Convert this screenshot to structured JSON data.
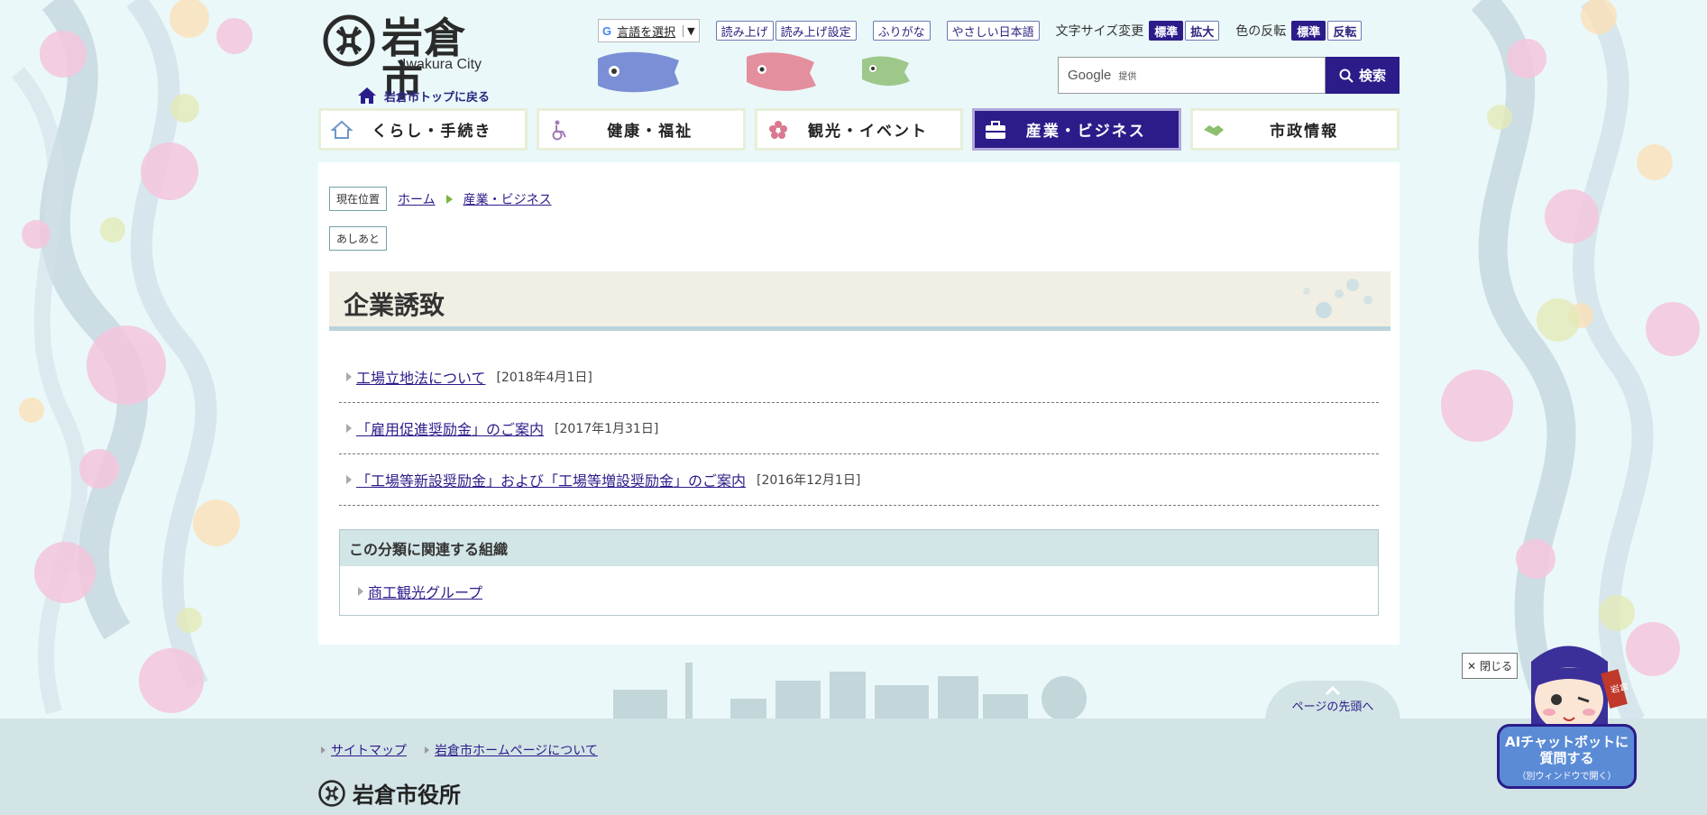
{
  "header": {
    "logo_title": "岩倉市",
    "logo_sub": "Iwakura City",
    "home_link": "岩倉市トップに戻る"
  },
  "util": {
    "lang_google": "G",
    "lang_label": "言語を選択",
    "lang_arrow": "▼",
    "read_aloud": "読み上げ",
    "read_settings": "読み上げ設定",
    "furigana": "ふりがな",
    "easy_japanese": "やさしい日本語",
    "font_size_label": "文字サイズ変更",
    "font_standard": "標準",
    "font_large": "拡大",
    "color_label": "色の反転",
    "color_standard": "標準",
    "color_invert": "反転"
  },
  "search": {
    "google": "Google",
    "provided": "提供",
    "button": "検索"
  },
  "nav": {
    "items": [
      {
        "label": "くらし・手続き"
      },
      {
        "label": "健康・福祉"
      },
      {
        "label": "観光・イベント"
      },
      {
        "label": "産業・ビジネス"
      },
      {
        "label": "市政情報"
      }
    ]
  },
  "breadcrumb": {
    "current_label": "現在位置",
    "home": "ホーム",
    "current": "産業・ビジネス",
    "ashiato": "あしあと"
  },
  "page": {
    "title": "企業誘致"
  },
  "articles": [
    {
      "title": "工場立地法について",
      "date": "[2018年4月1日]"
    },
    {
      "title": "「雇用促進奨励金」のご案内",
      "date": "[2017年1月31日]"
    },
    {
      "title": "「工場等新設奨励金」および「工場等増設奨励金」のご案内",
      "date": "[2016年12月1日]"
    }
  ],
  "org": {
    "heading": "この分類に関連する組織",
    "link": "商工観光グループ"
  },
  "footer": {
    "pagetop": "ページの先頭へ",
    "sitemap": "サイトマップ",
    "about": "岩倉市ホームページについて",
    "office": "岩倉市役所"
  },
  "chatbot": {
    "close": "閉じる",
    "line1": "AIチャットボットに",
    "line2": "質問する",
    "line3": "（別ウィンドウで開く）",
    "badge": "岩倉"
  },
  "colors": {
    "accent": "#2b1c8a",
    "background": "#eaf8f9",
    "footer": "#d3e4e6"
  }
}
